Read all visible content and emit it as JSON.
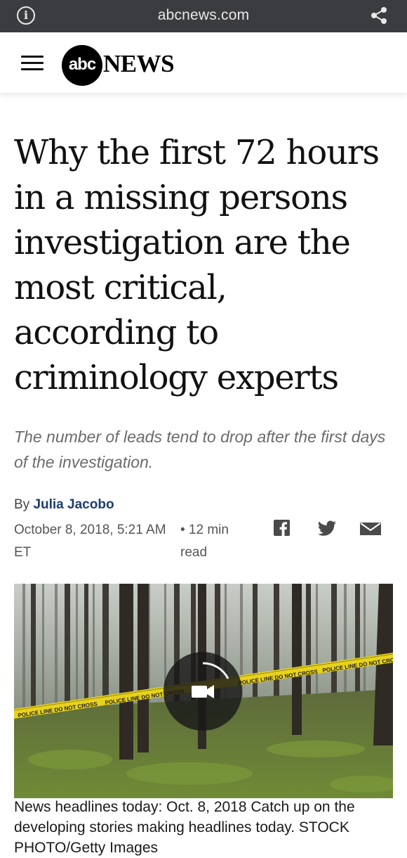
{
  "browser": {
    "host": "abcnews.com",
    "icons": [
      "info-icon",
      "share-icon"
    ]
  },
  "site": {
    "logo_circle": "abc",
    "logo_word": "NEWS"
  },
  "article": {
    "headline": "Why the first 72 hours in a missing persons investigation are the most critical, according to criminology experts",
    "subhead": "The number of leads tend to drop after the first days of the investigation.",
    "byline_prefix": "By ",
    "author": "Julia Jacobo",
    "date": "October 8, 2018, 5:21 AM ET",
    "read_time": "• 12 min read",
    "caption": "News headlines today: Oct. 8, 2018 Catch up on the developing stories making headlines today. STOCK PHOTO/Getty Images"
  },
  "tape_text": "POLICE LINE DO NOT CROSS",
  "colors": {
    "urlbar": "#3b3c3f",
    "author_link": "#1d3d6d",
    "tape": "#e8d21a"
  }
}
